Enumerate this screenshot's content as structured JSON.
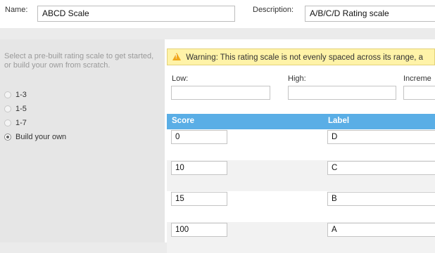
{
  "header": {
    "name_label": "Name:",
    "name_value": "ABCD Scale",
    "description_label": "Description:",
    "description_value": "A/B/C/D Rating scale"
  },
  "sidebar": {
    "hint": "Select a pre-built rating scale to get started, or build your own from scratch.",
    "options": [
      {
        "label": "1-3",
        "selected": false
      },
      {
        "label": "1-5",
        "selected": false
      },
      {
        "label": "1-7",
        "selected": false
      },
      {
        "label": "Build your own",
        "selected": true
      }
    ]
  },
  "main": {
    "warning": "Warning: This rating scale is not evenly spaced across its range, a",
    "low_label": "Low:",
    "high_label": "High:",
    "increment_label": "Increme",
    "table": {
      "columns": [
        "Score",
        "Label"
      ],
      "rows": [
        {
          "score": "0",
          "label": "D"
        },
        {
          "score": "10",
          "label": "C"
        },
        {
          "score": "15",
          "label": "B"
        },
        {
          "score": "100",
          "label": "A"
        }
      ]
    }
  },
  "colors": {
    "table_header": "#5aaee6",
    "warning_bg": "#fff3a8",
    "warning_icon": "#f0a81c",
    "sidebar_bg": "#e6e6e6"
  }
}
